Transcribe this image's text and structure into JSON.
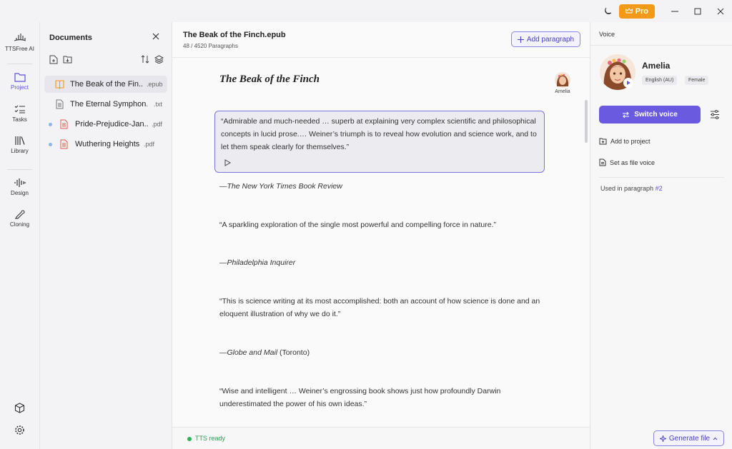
{
  "titlebar": {
    "pro_label": "Pro"
  },
  "nav": {
    "brand": "TTSFree AI",
    "items": [
      {
        "label": "Project"
      },
      {
        "label": "Tasks"
      },
      {
        "label": "Library"
      },
      {
        "label": "Design"
      },
      {
        "label": "Cloning"
      }
    ]
  },
  "documents": {
    "title": "Documents",
    "items": [
      {
        "name": "The Beak of the Fin...",
        "ext": ".epub"
      },
      {
        "name": "The Eternal Symphon...",
        "ext": ".txt"
      },
      {
        "name": "Pride-Prejudice-Jan...",
        "ext": ".pdf"
      },
      {
        "name": "Wuthering Heights",
        "ext": ".pdf"
      }
    ]
  },
  "editor": {
    "file_title": "The Beak of the Finch.epub",
    "paragraph_count": "48 / 4520 Paragraphs",
    "add_paragraph_label": "Add paragraph",
    "book_title": "The Beak of the Finch",
    "narrator_name": "Amelia",
    "paragraphs": [
      "“Admirable and much-needed … superb at explaining very complex scientific and philosophical concepts in lucid prose.… Weiner’s triumph is to reveal how evolution and science work, and to let them speak clearly for themselves.”",
      "—The New York Times Book Review",
      "“A sparkling exploration of the single most powerful and compelling force in nature.”",
      "—Philadelphia Inquirer",
      "“This is science writing at its most accomplished: both an account of how science is done and an eloquent illustration of why we do it.”",
      "—Globe and Mail",
      "(Toronto)",
      "“Wise and intelligent … Weiner’s engrossing book shows just how profoundly Darwin underestimated the power of his own ideas.”"
    ],
    "status": "TTS ready"
  },
  "voice_panel": {
    "header": "Voice",
    "name": "Amelia",
    "language_tag": "English (AU)",
    "gender_tag": "Female",
    "switch_label": "Switch voice",
    "add_to_project": "Add to project",
    "set_as_file_voice": "Set as file voice",
    "used_in": "Used in paragraph",
    "used_ref": "#2",
    "generate_label": "Generate file"
  },
  "colors": {
    "accent": "#6a5ae0",
    "pro": "#f29a16",
    "ready": "#2fb35a"
  }
}
